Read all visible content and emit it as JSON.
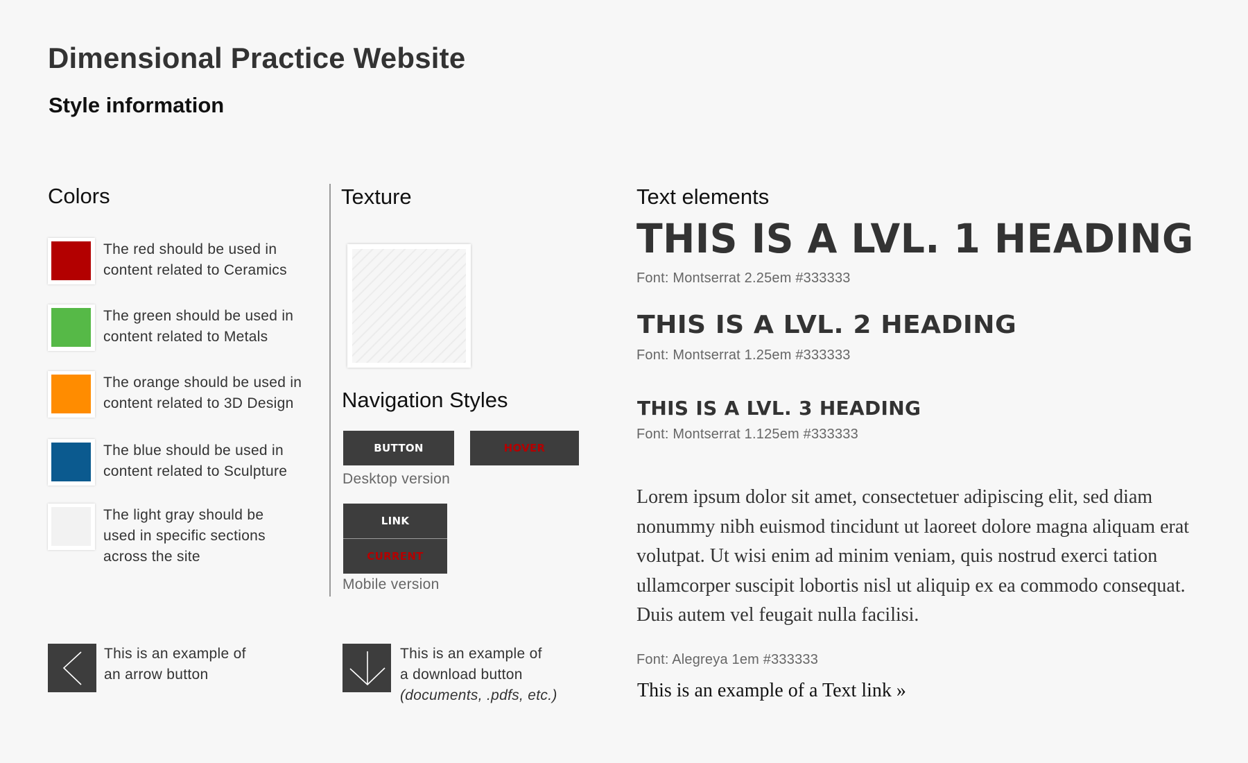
{
  "header": {
    "title": "Dimensional Practice Website",
    "subtitle": "Style information"
  },
  "colors": {
    "title": "Colors",
    "items": [
      {
        "name": "red",
        "hex": "#b30000",
        "description": "The red should be used in content related to Ceramics"
      },
      {
        "name": "green",
        "hex": "#56b947",
        "description": "The green should be used in content related to Metals"
      },
      {
        "name": "orange",
        "hex": "#ff8c00",
        "description": "The orange should be used in content related to 3D Design"
      },
      {
        "name": "blue",
        "hex": "#0b5a8f",
        "description": "The blue should be used in content related to Sculpture"
      },
      {
        "name": "light-gray",
        "hex": "#f2f2f2",
        "description": "The light gray should be used in specific sections across the site"
      }
    ]
  },
  "texture": {
    "title": "Texture"
  },
  "navigation": {
    "title": "Navigation Styles",
    "desktop": {
      "buttons": [
        {
          "label": "BUTTON",
          "state": "default"
        },
        {
          "label": "HOVER",
          "state": "hover"
        }
      ],
      "caption": "Desktop version"
    },
    "mobile": {
      "buttons": [
        {
          "label": "LINK",
          "state": "default"
        },
        {
          "label": "CURRENT",
          "state": "current"
        }
      ],
      "caption": "Mobile version"
    }
  },
  "icon_buttons": {
    "arrow": {
      "icon": "chevron-left-icon",
      "line1": "This is an example of",
      "line2": "an arrow button"
    },
    "download": {
      "icon": "download-arrow-icon",
      "line1": "This is an example of",
      "line2": "a download button",
      "line3": "(documents, .pdfs, etc.)"
    }
  },
  "text_elements": {
    "title": "Text elements",
    "h1": {
      "text": "THIS IS A LVL. 1 HEADING",
      "note": "Font: Montserrat 2.25em #333333"
    },
    "h2": {
      "text": "THIS IS A LVL. 2 HEADING",
      "note": "Font: Montserrat 1.25em #333333"
    },
    "h3": {
      "text": "THIS IS A LVL. 3 HEADING",
      "note": "Font: Montserrat 1.125em #333333"
    },
    "body": {
      "text": "Lorem ipsum dolor sit amet, consectetuer adipiscing elit, sed diam nonummy nibh euismod tincidunt ut laoreet dolore magna aliquam erat volutpat. Ut wisi enim ad minim veniam, quis nostrud exerci tation ullamcorper suscipit lobortis nisl ut aliquip ex ea commodo consequat. Duis autem vel feugait nulla facilisi.",
      "note": "Font: Alegreya 1em #333333"
    },
    "link": {
      "text": "This is an example of a Text link »"
    }
  },
  "theme": {
    "background": "#f7f7f7",
    "text": "#333333",
    "nav_bg": "#3d3d3d",
    "accent_red": "#b30000"
  }
}
